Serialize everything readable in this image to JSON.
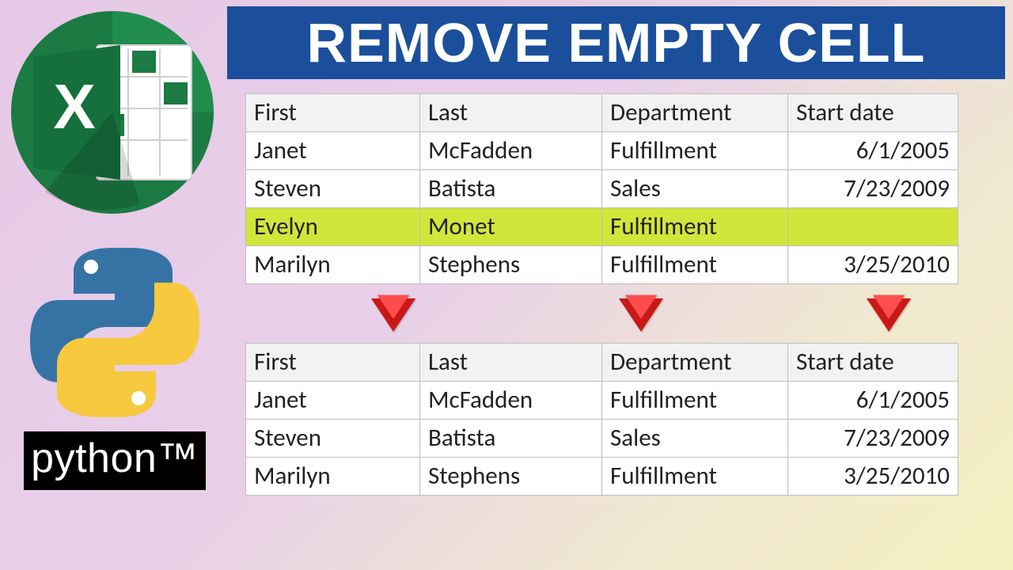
{
  "title": "REMOVE EMPTY CELL",
  "python_label": "python™",
  "columns": [
    "First",
    "Last",
    "Department",
    "Start date"
  ],
  "table_before": [
    {
      "first": "Janet",
      "last": "McFadden",
      "dept": "Fulfillment",
      "date": "6/1/2005",
      "hl": false
    },
    {
      "first": "Steven",
      "last": "Batista",
      "dept": "Sales",
      "date": "7/23/2009",
      "hl": false
    },
    {
      "first": "Evelyn",
      "last": "Monet",
      "dept": "Fulfillment",
      "date": "",
      "hl": true
    },
    {
      "first": "Marilyn",
      "last": "Stephens",
      "dept": "Fulfillment",
      "date": "3/25/2010",
      "hl": false
    }
  ],
  "table_after": [
    {
      "first": "Janet",
      "last": "McFadden",
      "dept": "Fulfillment",
      "date": "6/1/2005"
    },
    {
      "first": "Steven",
      "last": "Batista",
      "dept": "Sales",
      "date": "7/23/2009"
    },
    {
      "first": "Marilyn",
      "last": "Stephens",
      "dept": "Fulfillment",
      "date": "3/25/2010"
    }
  ]
}
